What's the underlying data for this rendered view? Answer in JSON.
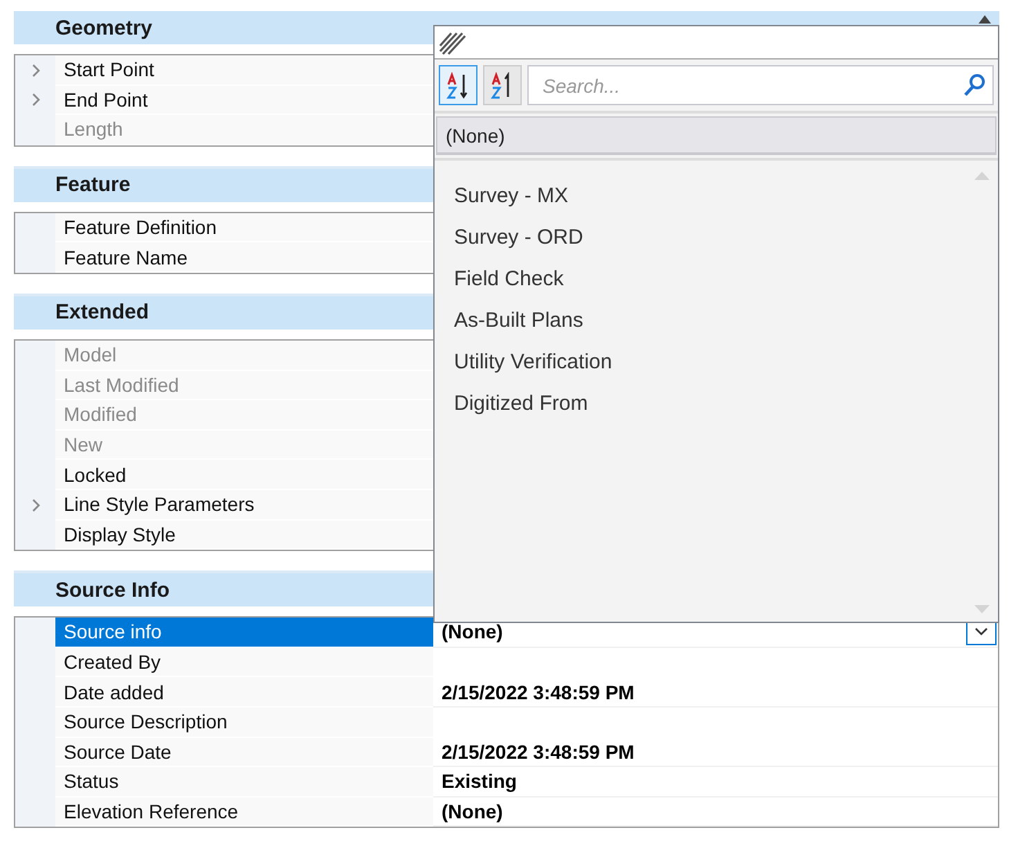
{
  "sections": [
    {
      "title": "Geometry",
      "rows": [
        {
          "label": "Start Point",
          "disabled": false,
          "expander": true,
          "selected": false,
          "kind": "text"
        },
        {
          "label": "End Point",
          "disabled": false,
          "expander": true,
          "selected": false,
          "kind": "text"
        },
        {
          "label": "Length",
          "disabled": true,
          "expander": false,
          "selected": false,
          "kind": "text"
        }
      ]
    },
    {
      "title": "Feature",
      "rows": [
        {
          "label": "Feature Definition",
          "disabled": false,
          "expander": false,
          "selected": false,
          "kind": "text"
        },
        {
          "label": "Feature Name",
          "disabled": false,
          "expander": false,
          "selected": false,
          "kind": "text"
        }
      ]
    },
    {
      "title": "Extended",
      "rows": [
        {
          "label": "Model",
          "disabled": true,
          "expander": false,
          "selected": false,
          "kind": "text"
        },
        {
          "label": "Last Modified",
          "disabled": true,
          "expander": false,
          "selected": false,
          "kind": "text"
        },
        {
          "label": "Modified",
          "disabled": true,
          "expander": false,
          "selected": false,
          "kind": "text"
        },
        {
          "label": "New",
          "disabled": true,
          "expander": false,
          "selected": false,
          "kind": "text"
        },
        {
          "label": "Locked",
          "disabled": false,
          "expander": false,
          "selected": false,
          "kind": "text"
        },
        {
          "label": "Line Style Parameters",
          "disabled": false,
          "expander": true,
          "selected": false,
          "kind": "text"
        },
        {
          "label": "Display Style",
          "disabled": false,
          "expander": false,
          "selected": false,
          "kind": "text"
        }
      ]
    },
    {
      "title": "Source Info",
      "rows": [
        {
          "label": "Source info",
          "value": "(None)",
          "disabled": false,
          "expander": false,
          "selected": true,
          "kind": "dropdown"
        },
        {
          "label": "Created By",
          "disabled": false,
          "expander": false,
          "selected": false,
          "kind": "text"
        },
        {
          "label": "Date added",
          "value": "2/15/2022 3:48:59 PM",
          "disabled": false,
          "expander": false,
          "selected": false,
          "kind": "text"
        },
        {
          "label": "Source Description",
          "disabled": false,
          "expander": false,
          "selected": false,
          "kind": "text"
        },
        {
          "label": "Source Date",
          "value": "2/15/2022 3:48:59 PM",
          "disabled": false,
          "expander": false,
          "selected": false,
          "kind": "text"
        },
        {
          "label": "Status",
          "value": "Existing",
          "disabled": false,
          "expander": false,
          "selected": false,
          "kind": "text"
        },
        {
          "label": "Elevation Reference",
          "value": "(None)",
          "disabled": false,
          "expander": false,
          "selected": false,
          "kind": "text"
        }
      ]
    }
  ],
  "popup": {
    "sort_buttons": [
      {
        "kind": "ascending",
        "selected": true
      },
      {
        "kind": "descending",
        "selected": false
      }
    ],
    "search": {
      "placeholder": "Search..."
    },
    "pinned_item": {
      "label": "(None)",
      "selected": true
    },
    "items": [
      {
        "label": "Survey - MX",
        "selected": false
      },
      {
        "label": "Survey - ORD",
        "selected": false
      },
      {
        "label": "Field Check",
        "selected": false
      },
      {
        "label": "As-Built Plans",
        "selected": false
      },
      {
        "label": "Utility Verification",
        "selected": false
      },
      {
        "label": "Digitized From",
        "selected": false
      }
    ]
  }
}
